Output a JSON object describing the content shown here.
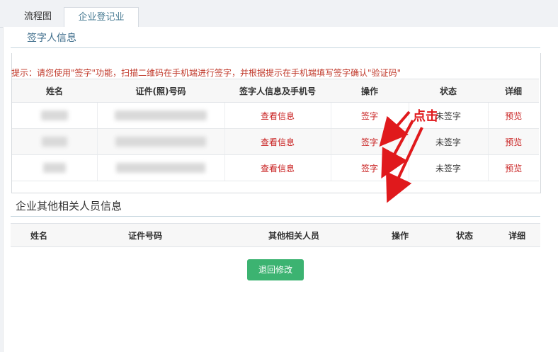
{
  "tabs": [
    {
      "label": "流程图"
    },
    {
      "label": "企业登记业务"
    }
  ],
  "signer_section": {
    "title": "签字人信息",
    "hint": "提示：请您使用\"签字\"功能，扫描二维码在手机端进行签字，并根据提示在手机端填写签字确认\"验证码\"",
    "columns": [
      "姓名",
      "证件(照)号码",
      "签字人信息及手机号",
      "操作",
      "状态",
      "详细"
    ],
    "rows": [
      {
        "info": "查看信息",
        "action": "签字",
        "status": "未签字",
        "detail": "预览"
      },
      {
        "info": "查看信息",
        "action": "签字",
        "status": "未签字",
        "detail": "预览"
      },
      {
        "info": "查看信息",
        "action": "签字",
        "status": "未签字",
        "detail": "预览"
      }
    ]
  },
  "others_section": {
    "title": "企业其他相关人员信息",
    "columns": [
      "姓名",
      "证件号码",
      "其他相关人员",
      "操作",
      "状态",
      "详细"
    ]
  },
  "back_button": "退回修改",
  "annotation": {
    "label": "点击",
    "color": "#e0191c"
  },
  "colors": {
    "accent": "#3f6e8c",
    "button": "#3cb371",
    "link": "#c81e1e"
  }
}
